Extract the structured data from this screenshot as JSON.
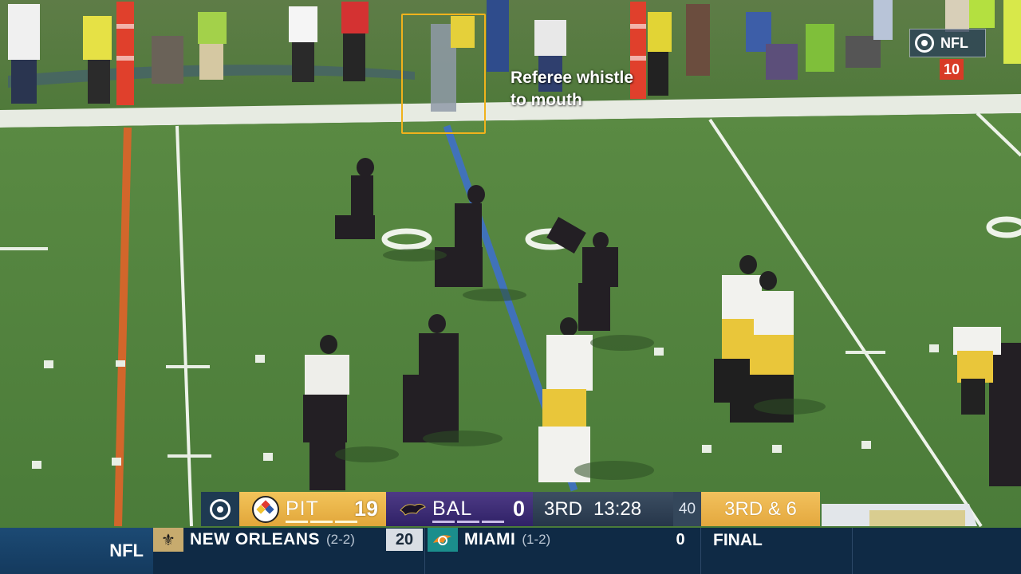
{
  "annotation": {
    "label": "Referee whistle\nto mouth",
    "color": "#f0b21c"
  },
  "network_bug": {
    "icon": "cbs-eye-icon",
    "text": "NFL",
    "down_marker": "10"
  },
  "scorebug": {
    "home": {
      "abbr": "PIT",
      "score": "19",
      "color": "#e9b447",
      "logo": "steelers-logo"
    },
    "away": {
      "abbr": "BAL",
      "score": "0",
      "color": "#3c2b78",
      "logo": "ravens-logo"
    },
    "quarter": "3RD",
    "clock": "13:28",
    "play_clock": "40",
    "down_distance": "3RD & 6"
  },
  "ticker": {
    "label": "NFL",
    "game": {
      "team1": {
        "name": "NEW ORLEANS",
        "record": "(2-2)",
        "score": "20",
        "logo": "saints-logo"
      },
      "team2": {
        "name": "MIAMI",
        "record": "(1-2)",
        "score": "0",
        "logo": "dolphins-logo"
      },
      "status": "FINAL"
    }
  },
  "colors": {
    "field": "#4d7f3b",
    "yellow_accent": "#f0b21c"
  }
}
